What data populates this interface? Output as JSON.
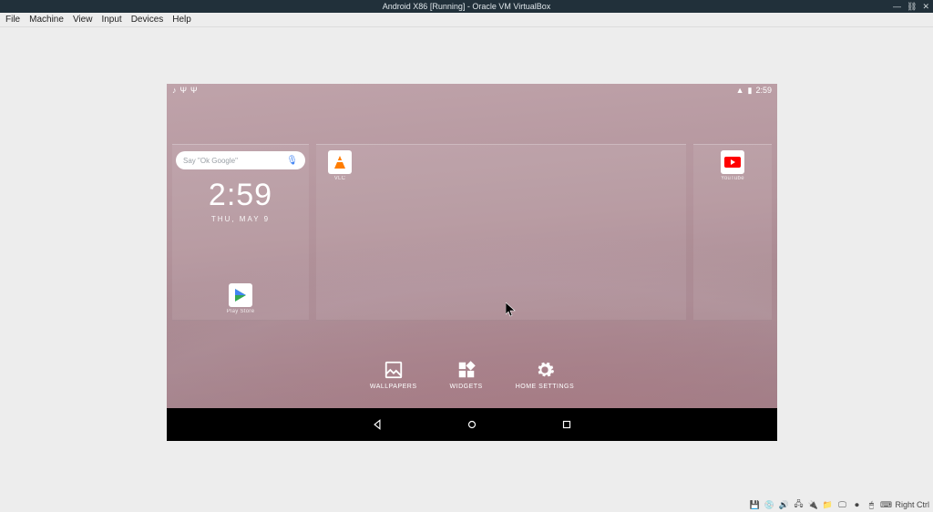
{
  "window": {
    "title": "Android X86 [Running] - Oracle VM VirtualBox",
    "controls": {
      "min": "—",
      "unlink": "⛓",
      "close": "✕"
    }
  },
  "menubar": [
    "File",
    "Machine",
    "View",
    "Input",
    "Devices",
    "Help"
  ],
  "vb_status": {
    "icons": [
      "hdd-icon",
      "disc-icon",
      "audio-icon",
      "net-icon",
      "usb-icon",
      "shared-icon",
      "display-icon",
      "rec-icon",
      "mouse-icon",
      "kb-icon"
    ],
    "host_key": "Right Ctrl"
  },
  "android": {
    "status": {
      "left": [
        "music-icon",
        "usb-icon",
        "usb-icon"
      ],
      "right": {
        "wifi": "wifi-icon",
        "battery": "battery-icon",
        "time": "2:59"
      }
    },
    "search": {
      "placeholder": "Say \"Ok Google\"",
      "mic": "🎤"
    },
    "clock": {
      "time": "2:59",
      "date": "THU, MAY 9"
    },
    "apps": {
      "playstore": {
        "label": "Play Store"
      },
      "vlc": {
        "label": "VLC"
      },
      "youtube": {
        "label": "YouTube"
      }
    },
    "options": {
      "wallpapers": "WALLPAPERS",
      "widgets": "WIDGETS",
      "settings": "HOME SETTINGS"
    },
    "nav": {
      "back": "◁",
      "home": "○",
      "recent": "□"
    }
  }
}
